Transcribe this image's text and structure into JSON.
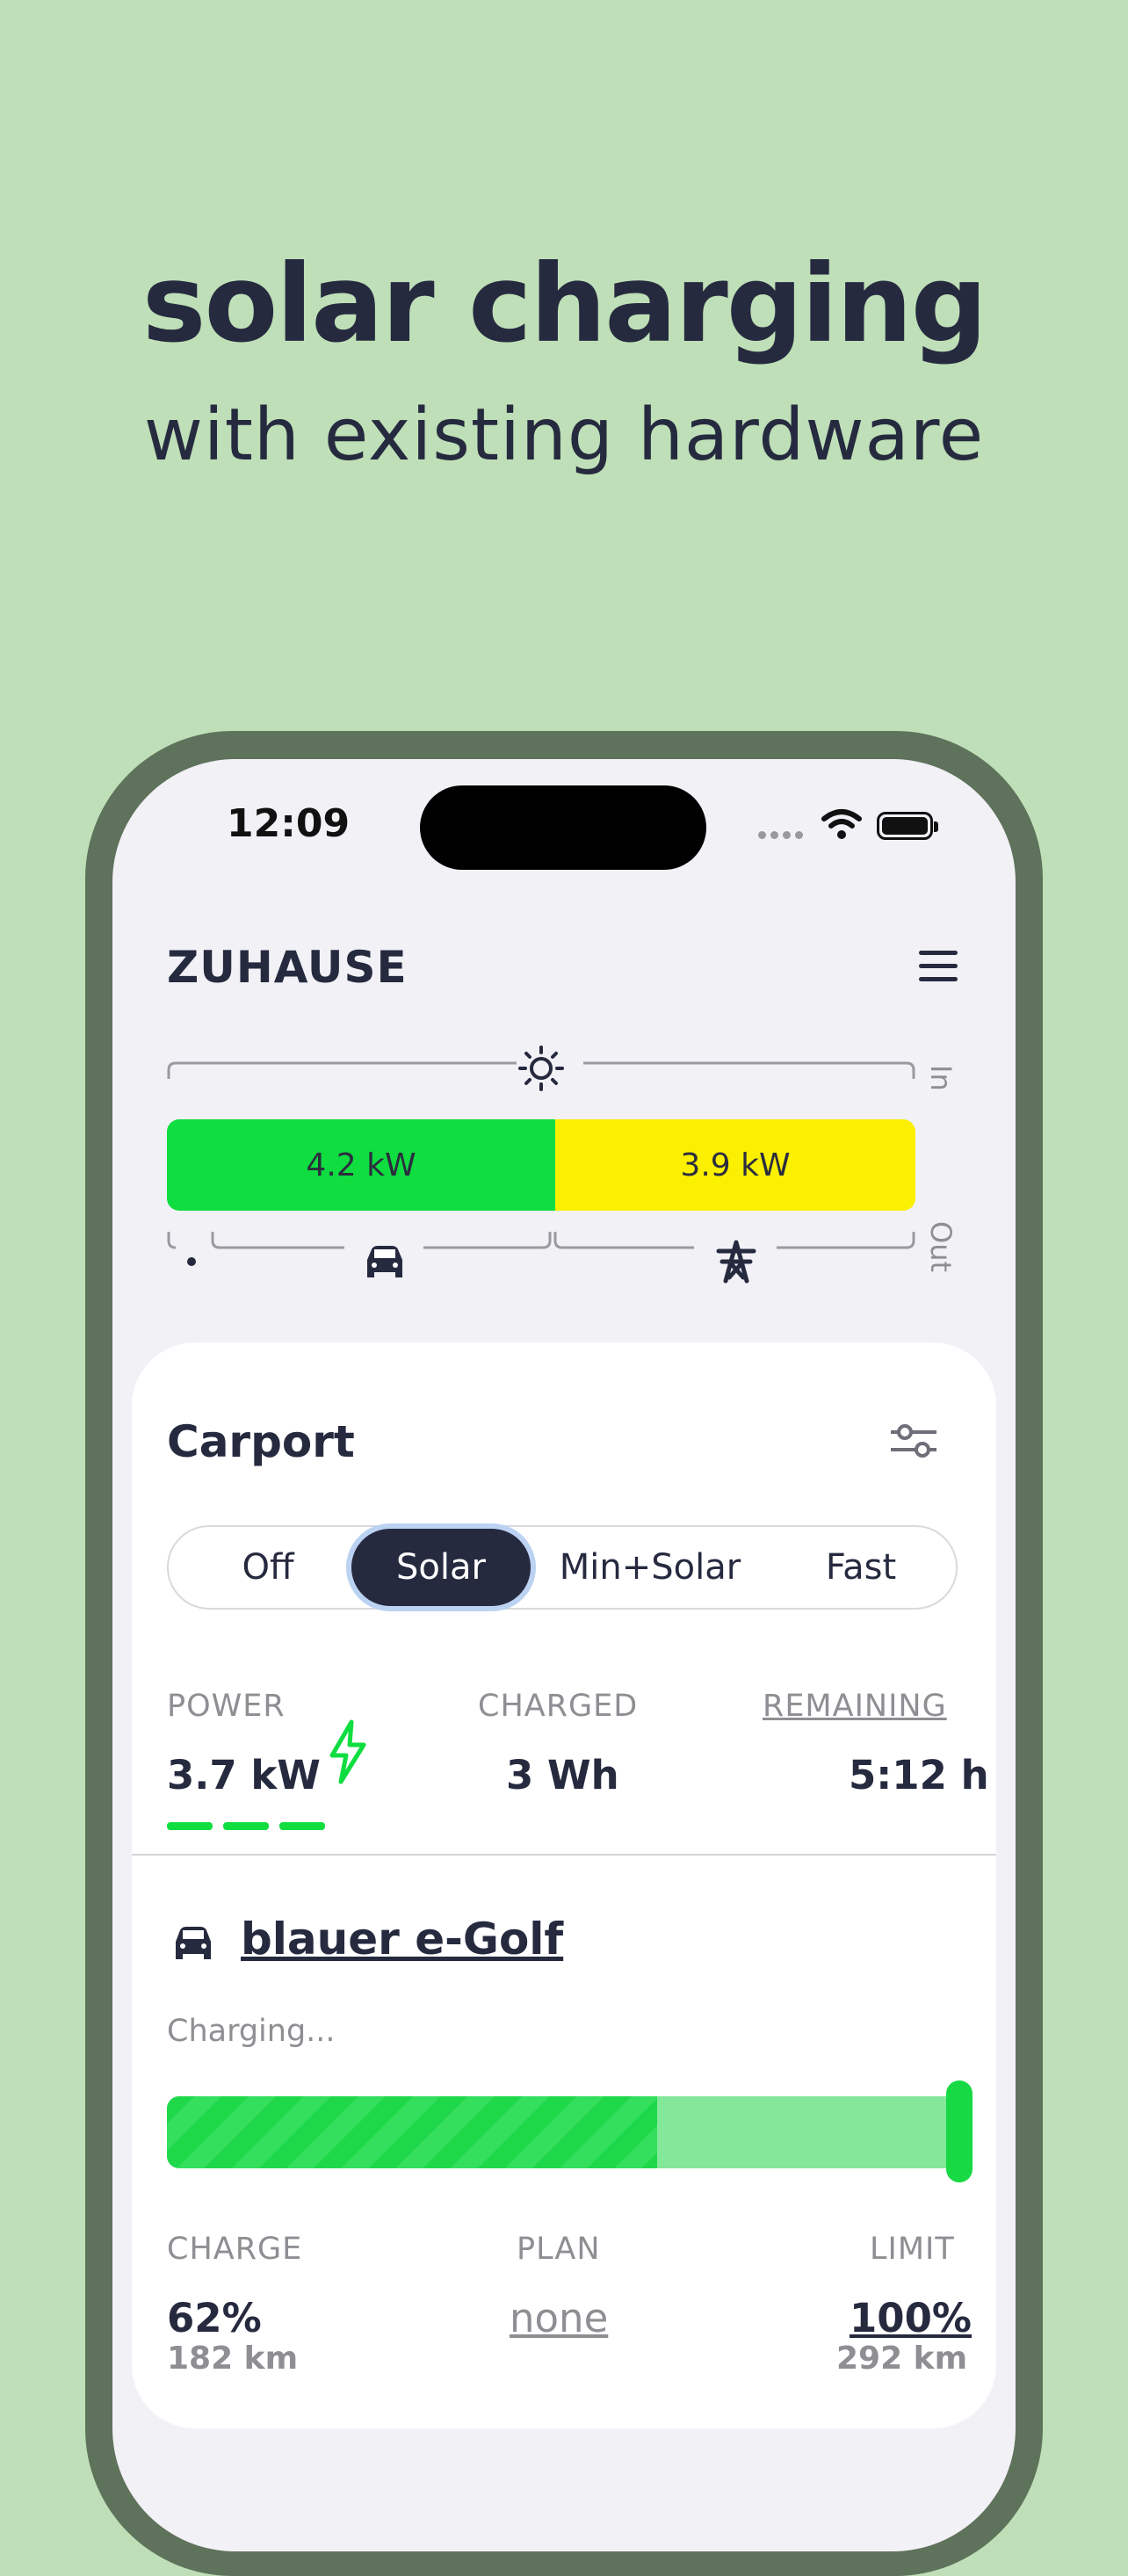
{
  "headline": {
    "title": "solar charging",
    "subtitle": "with existing hardware"
  },
  "status_bar": {
    "time": "12:09"
  },
  "site": {
    "title": "ZUHAUSE"
  },
  "energy_flow": {
    "in_label": "In",
    "out_label": "Out",
    "solar_power": "4.2 kW",
    "grid_power": "3.9 kW",
    "colors": {
      "solar": "#0fdd40",
      "grid": "#faf000"
    },
    "icons": {
      "source": "sun-icon",
      "consumer": "car-icon",
      "grid": "power-tower-icon"
    }
  },
  "loadpoint": {
    "title": "Carport",
    "modes": [
      "Off",
      "Solar",
      "Min+Solar",
      "Fast"
    ],
    "selected_mode": "Solar",
    "power_label": "POWER",
    "power_value": "3.7 kW",
    "charged_label": "CHARGED",
    "charged_value": "3 Wh",
    "remaining_label": "REMAINING",
    "remaining_value": "5:12 h"
  },
  "vehicle": {
    "name": "blauer e-Golf",
    "status": "Charging...",
    "soc_fraction": 0.62,
    "charge_label": "CHARGE",
    "charge_value": "62%",
    "charge_range": "182 km",
    "plan_label": "PLAN",
    "plan_value": "none",
    "limit_label": "LIMIT",
    "limit_value": "100%",
    "limit_range": "292 km"
  }
}
